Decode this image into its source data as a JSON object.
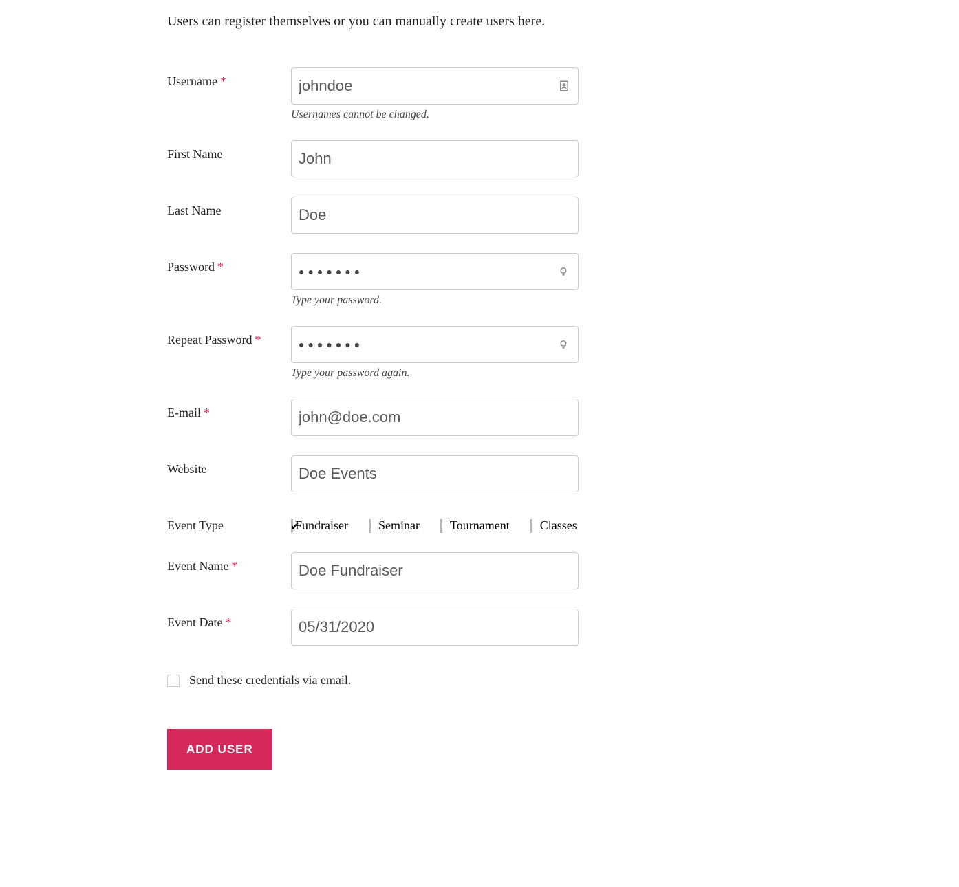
{
  "intro": "Users can register themselves or you can manually create users here.",
  "fields": {
    "username": {
      "label": "Username",
      "required": "*",
      "value": "johndoe",
      "help": "Usernames cannot be changed."
    },
    "firstName": {
      "label": "First Name",
      "value": "John"
    },
    "lastName": {
      "label": "Last Name",
      "value": "Doe"
    },
    "password": {
      "label": "Password",
      "required": "*",
      "dots": "●●●●●●●",
      "help": "Type your password."
    },
    "repeatPassword": {
      "label": "Repeat Password",
      "required": "*",
      "dots": "●●●●●●●",
      "help": "Type your password again."
    },
    "email": {
      "label": "E-mail",
      "required": "*",
      "value": "john@doe.com"
    },
    "website": {
      "label": "Website",
      "value": "Doe Events"
    },
    "eventType": {
      "label": "Event Type",
      "options": {
        "fundraiser": "Fundraiser",
        "seminar": "Seminar",
        "tournament": "Tournament",
        "classes": "Classes"
      }
    },
    "eventName": {
      "label": "Event Name",
      "required": "*",
      "value": "Doe Fundraiser"
    },
    "eventDate": {
      "label": "Event Date",
      "required": "*",
      "value": "05/31/2020"
    }
  },
  "sendCredentials": {
    "label": "Send these credentials via email."
  },
  "submit": {
    "label": "ADD USER"
  }
}
